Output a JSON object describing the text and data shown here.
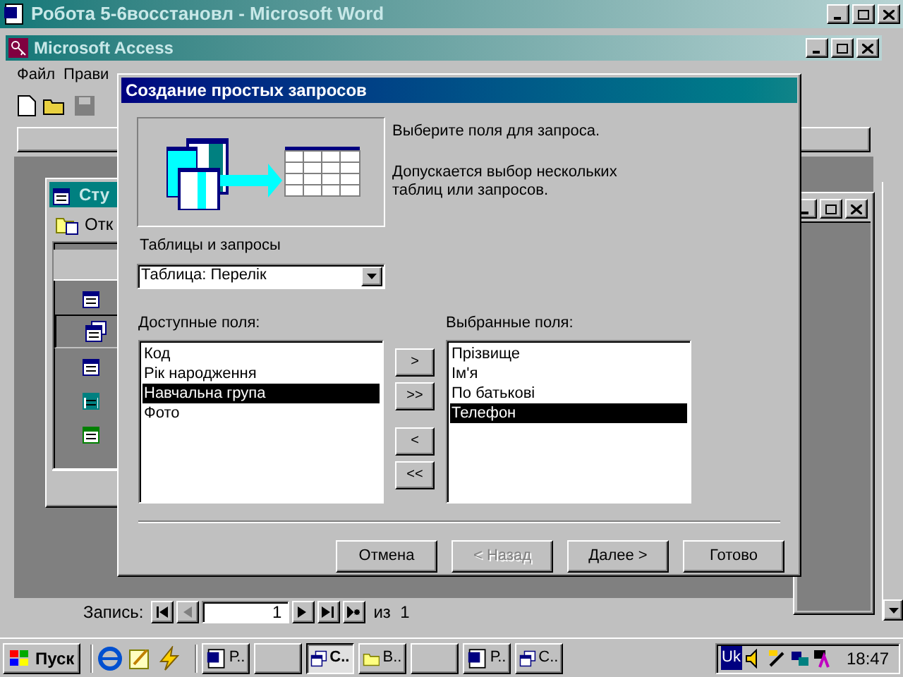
{
  "word_window": {
    "title": "Робота 5-6восстановл - Microsoft Word"
  },
  "access_window": {
    "title": "Microsoft Access",
    "menu": [
      "Файл",
      "Прави"
    ]
  },
  "db_window": {
    "title": "Сту",
    "open_button": "Отк",
    "objects": [
      {
        "kind": "table",
        "selected": false
      },
      {
        "kind": "query",
        "selected": true
      },
      {
        "kind": "form",
        "selected": false
      },
      {
        "kind": "report",
        "selected": false
      },
      {
        "kind": "page",
        "selected": false
      }
    ]
  },
  "dialog": {
    "title": "Создание простых запросов",
    "intro": "Выберите поля для запроса.",
    "note": "Допускается выбор нескольких таблиц или запросов.",
    "tables_label": "Таблицы и запросы",
    "table_select": "Таблица: Перелік",
    "available_label": "Доступные поля:",
    "selected_label": "Выбранные поля:",
    "available_fields": [
      {
        "label": "Код",
        "selected": false
      },
      {
        "label": "Рік народження",
        "selected": false
      },
      {
        "label": "Навчальна група",
        "selected": true
      },
      {
        "label": "Фото",
        "selected": false
      }
    ],
    "selected_fields": [
      {
        "label": "Прізвище",
        "selected": false
      },
      {
        "label": "Ім'я",
        "selected": false
      },
      {
        "label": "По батькові",
        "selected": false
      },
      {
        "label": "Телефон",
        "selected": true
      }
    ],
    "move_buttons": [
      ">",
      ">>",
      "<",
      "<<"
    ],
    "buttons": [
      {
        "label": "Отмена",
        "disabled": false
      },
      {
        "label": "< Назад",
        "disabled": true
      },
      {
        "label": "Далее >",
        "disabled": false
      },
      {
        "label": "Готово",
        "disabled": false
      }
    ]
  },
  "record_nav": {
    "label": "Запись:",
    "value": "1",
    "count": "из  1"
  },
  "taskbar": {
    "start": "Пуск",
    "clock": "18:47",
    "language": "Uk",
    "items": [
      {
        "kind": "word",
        "label": "Р..",
        "selected": false
      },
      {
        "kind": "blank",
        "selected": false
      },
      {
        "kind": "access",
        "label": "С..",
        "selected": true
      },
      {
        "kind": "folder",
        "label": "В..",
        "selected": false
      },
      {
        "kind": "blank",
        "selected": false
      },
      {
        "kind": "word",
        "label": "Р..",
        "selected": false
      },
      {
        "kind": "access",
        "label": "С..",
        "selected": false
      }
    ]
  }
}
